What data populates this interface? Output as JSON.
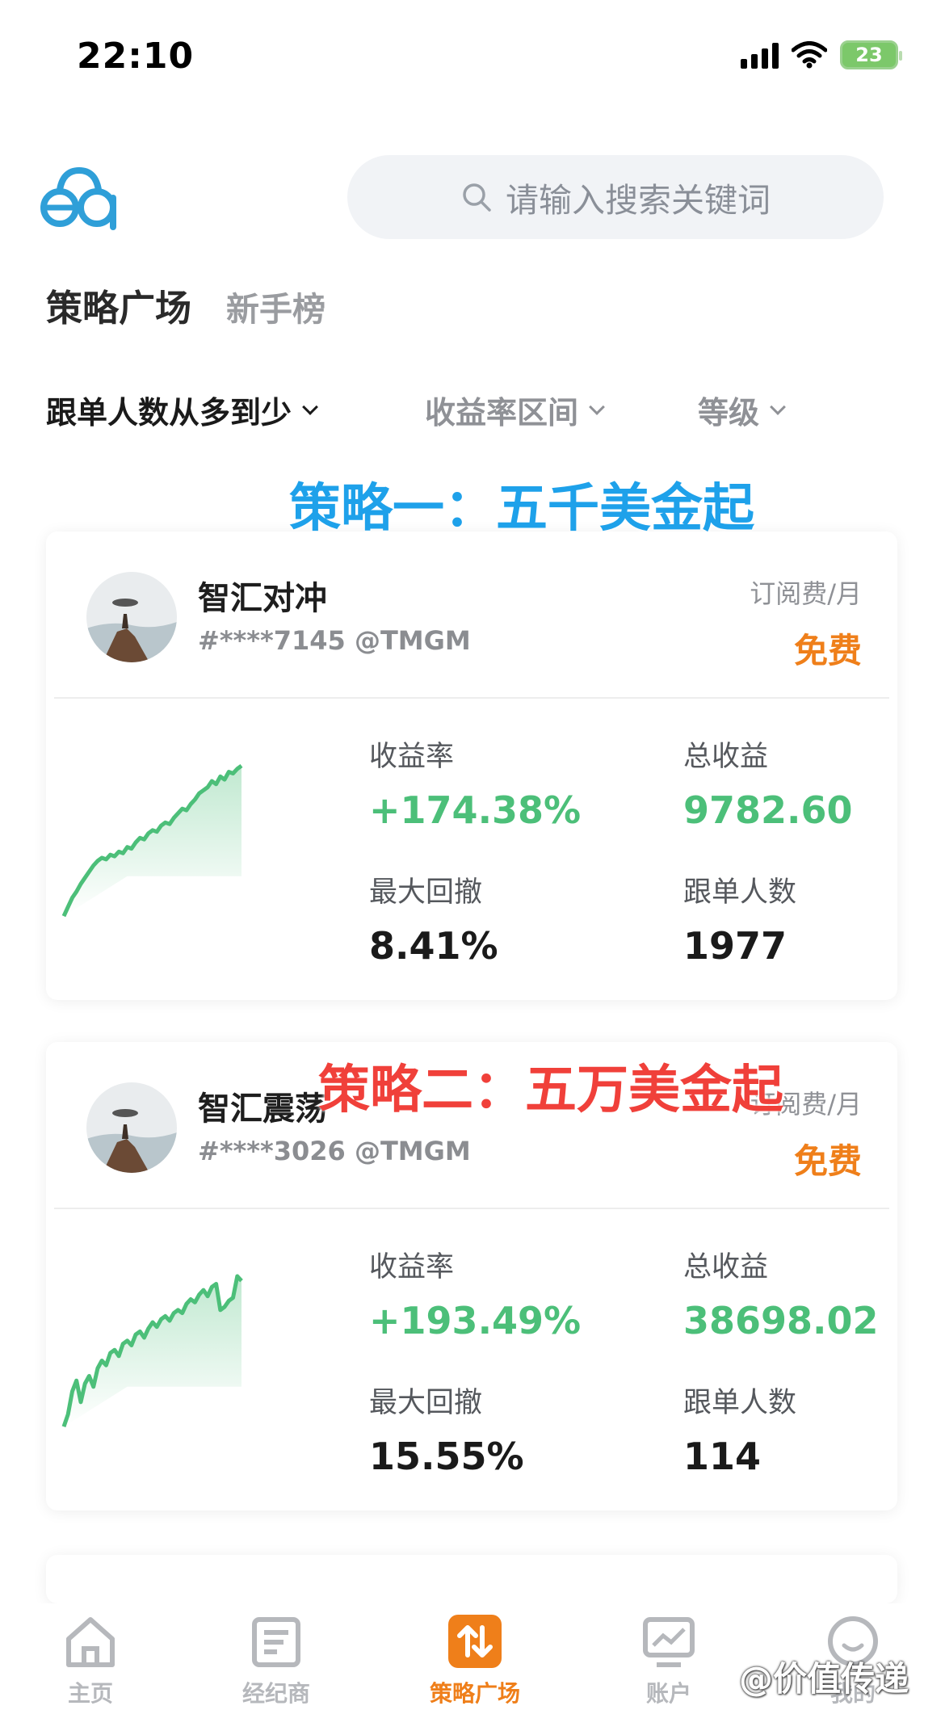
{
  "status_bar": {
    "time": "22:10",
    "battery": "23"
  },
  "header": {
    "search_placeholder": "请输入搜索关键词"
  },
  "section": {
    "title": "策略广场",
    "subtitle": "新手榜"
  },
  "filters": {
    "sort": "跟单人数从多到少",
    "return_range": "收益率区间",
    "level": "等级"
  },
  "annotations": {
    "first": "策略一：五千美金起",
    "second": "策略二：五万美金起"
  },
  "strategies": [
    {
      "name": "智汇对冲",
      "account": "#****7145 @TMGM",
      "fee_label": "订阅费/月",
      "fee": "免费",
      "return_label": "收益率",
      "return_value": "+174.38%",
      "profit_label": "总收益",
      "profit_value": "9782.60",
      "drawdown_label": "最大回撤",
      "drawdown_value": "8.41%",
      "followers_label": "跟单人数",
      "followers_value": "1977",
      "curve": [
        0.02,
        0.08,
        0.14,
        0.18,
        0.23,
        0.27,
        0.31,
        0.35,
        0.38,
        0.4,
        0.39,
        0.42,
        0.41,
        0.44,
        0.43,
        0.47,
        0.46,
        0.5,
        0.53,
        0.52,
        0.56,
        0.58,
        0.57,
        0.61,
        0.63,
        0.62,
        0.66,
        0.69,
        0.72,
        0.71,
        0.75,
        0.78,
        0.82,
        0.84,
        0.86,
        0.9,
        0.88,
        0.93,
        0.91,
        0.96,
        0.95,
        0.98,
        1.0
      ]
    },
    {
      "name": "智汇震荡",
      "account": "#****3026 @TMGM",
      "fee_label": "订阅费/月",
      "fee": "免费",
      "return_label": "收益率",
      "return_value": "+193.49%",
      "profit_label": "总收益",
      "profit_value": "38698.02",
      "drawdown_label": "最大回撤",
      "drawdown_value": "15.55%",
      "followers_label": "跟单人数",
      "followers_value": "114",
      "curve": [
        0.02,
        0.1,
        0.25,
        0.32,
        0.18,
        0.3,
        0.35,
        0.28,
        0.4,
        0.45,
        0.42,
        0.5,
        0.52,
        0.48,
        0.56,
        0.58,
        0.55,
        0.62,
        0.64,
        0.6,
        0.66,
        0.7,
        0.67,
        0.72,
        0.74,
        0.71,
        0.76,
        0.78,
        0.76,
        0.82,
        0.85,
        0.83,
        0.88,
        0.91,
        0.87,
        0.93,
        0.95,
        0.78,
        0.8,
        0.84,
        0.86,
        1.0,
        0.97
      ]
    }
  ],
  "nav": {
    "home": "主页",
    "broker": "经纪商",
    "strategy": "策略广场",
    "account": "账户",
    "me": "我的"
  },
  "watermark": "@价值传递",
  "colors": {
    "accent": "#ef7f1a",
    "positive": "#4cbf79",
    "annotation_blue": "#1ea1ea",
    "annotation_red": "#f0403a"
  }
}
